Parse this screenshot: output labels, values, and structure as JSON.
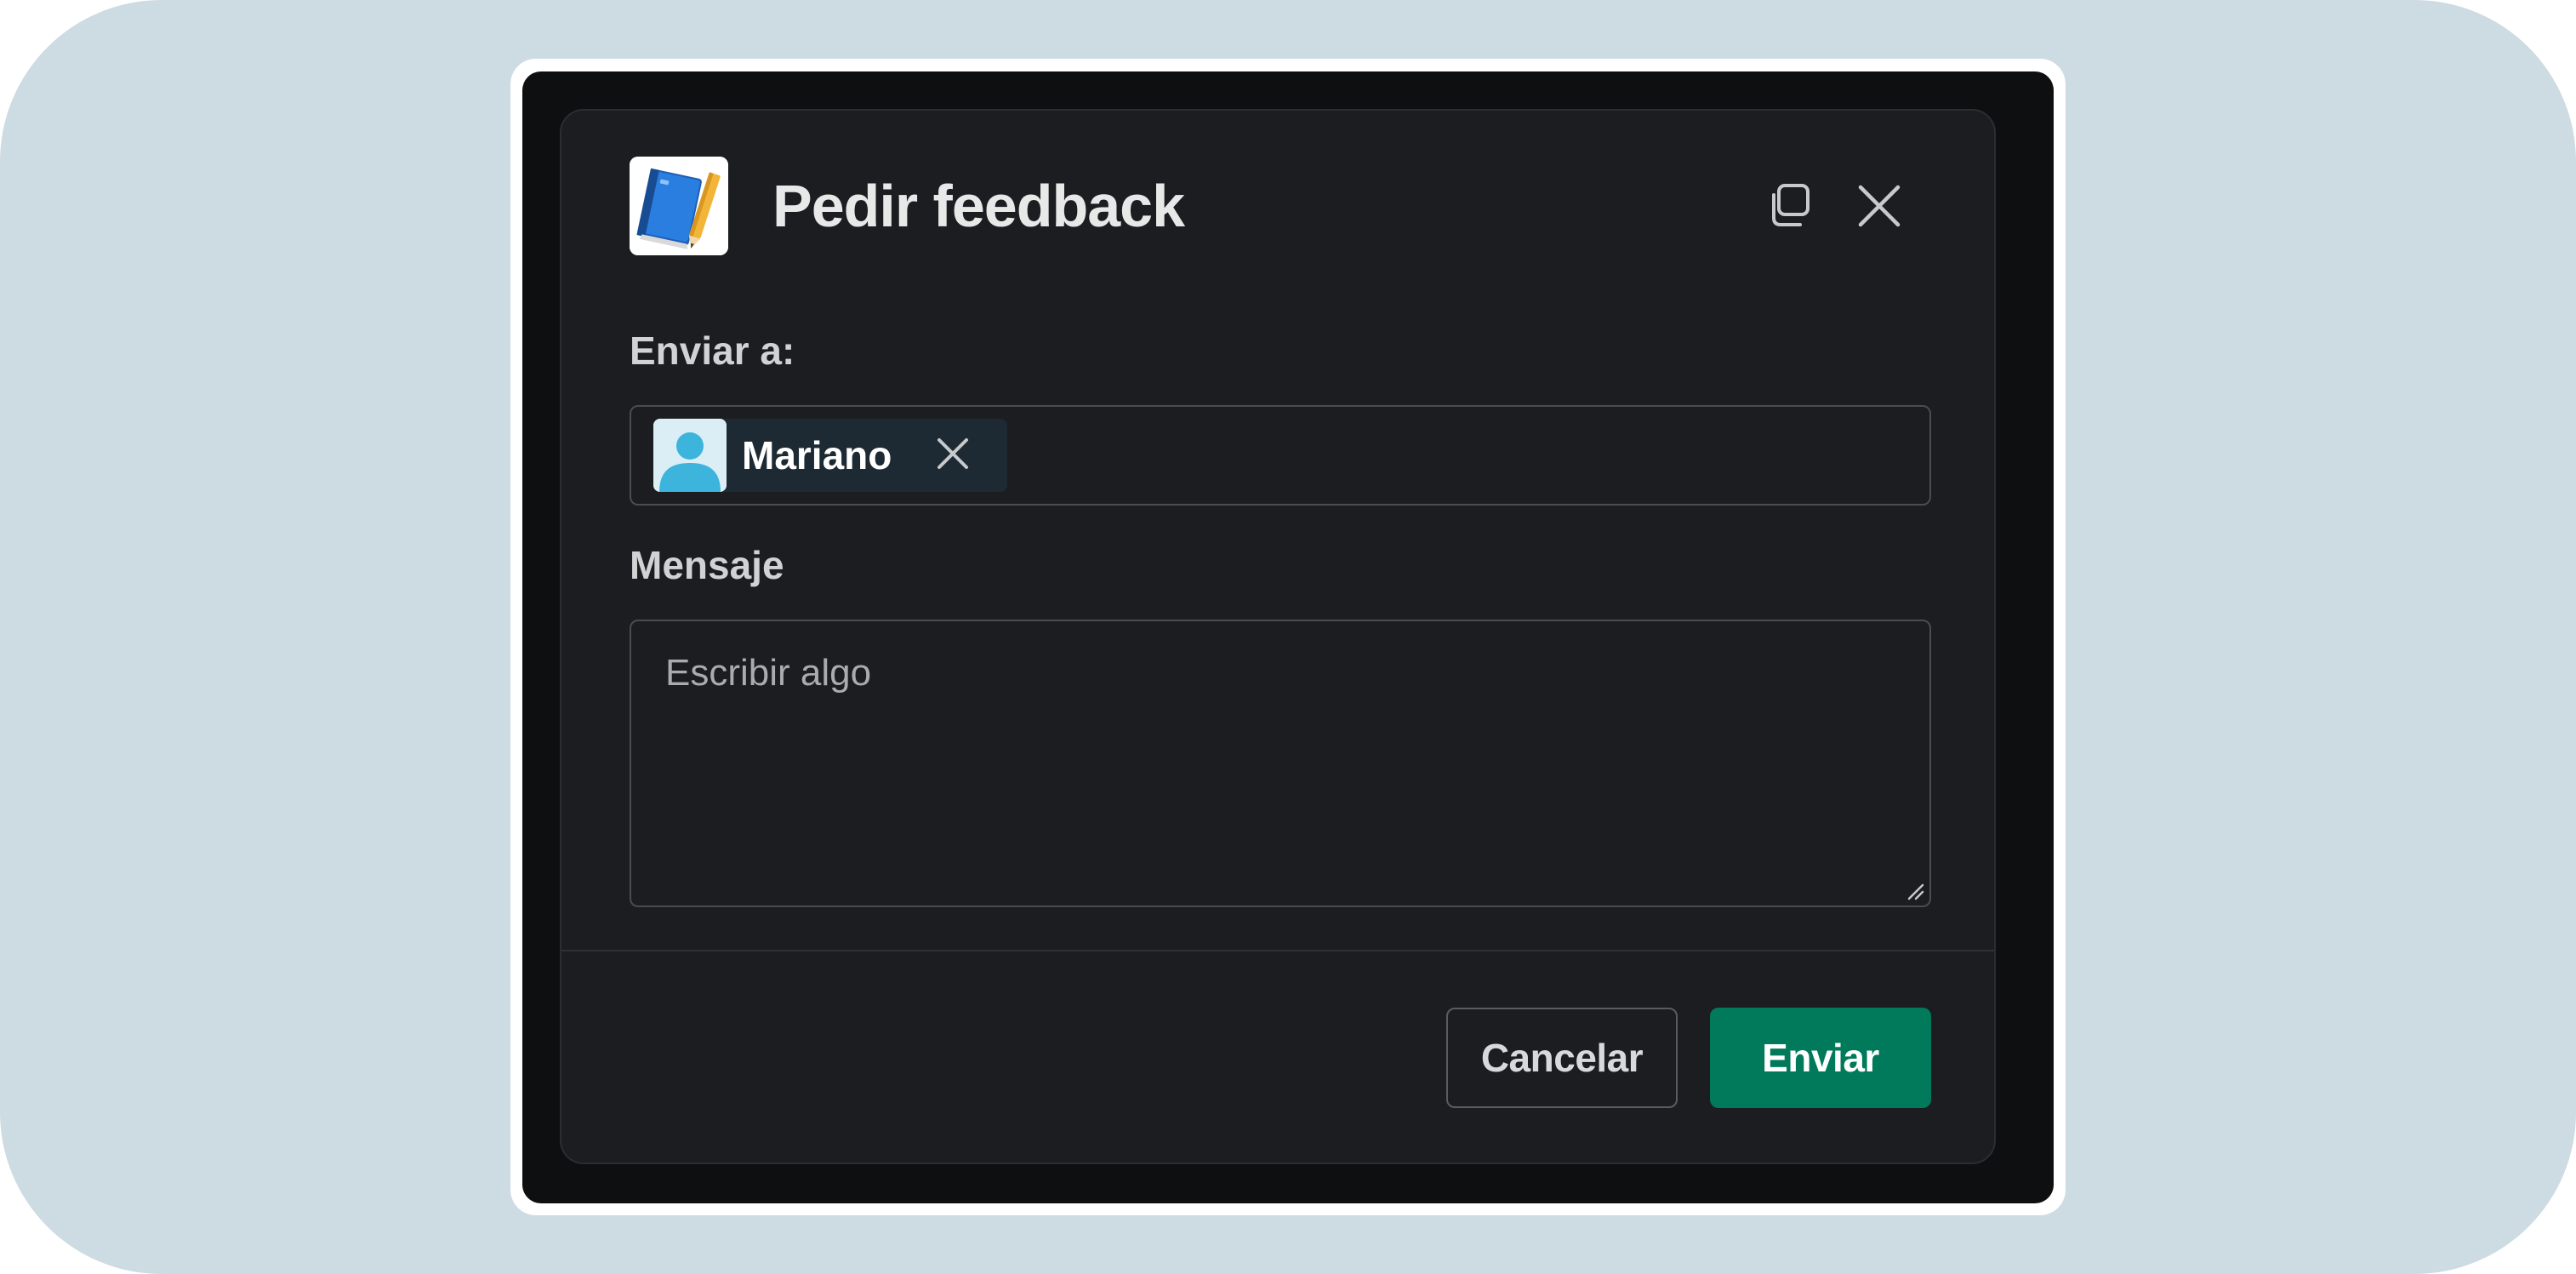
{
  "dialog": {
    "title": "Pedir feedback",
    "app_icon": "notebook-pencil-icon",
    "header_actions": {
      "popout_icon": "copy-window-icon",
      "close_icon": "close-icon"
    }
  },
  "form": {
    "to_label": "Enviar a:",
    "recipients": [
      {
        "name": "Mariano",
        "avatar": "user-avatar-icon"
      }
    ],
    "message_label": "Mensaje",
    "message_value": "",
    "message_placeholder": "Escribir algo"
  },
  "footer": {
    "cancel_label": "Cancelar",
    "send_label": "Enviar"
  },
  "colors": {
    "backdrop": "#cddbe2",
    "modal_bg": "#1b1d21",
    "primary_button": "#007a5a",
    "chip_bg": "#1d2a33"
  }
}
